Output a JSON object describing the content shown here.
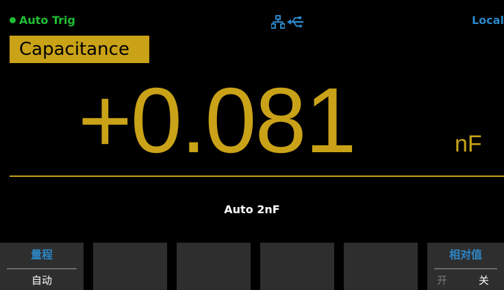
{
  "status": {
    "trigger_label": "Auto Trig",
    "network_icon": "lan-icon",
    "usb_icon": "usb-icon",
    "mode_label": "Local"
  },
  "function": {
    "label": "Capacitance"
  },
  "measurement": {
    "value": "+0.081",
    "unit": "nF"
  },
  "range_info": "Auto 2nF",
  "softkeys": [
    {
      "title": "量程",
      "value": "自动"
    },
    {
      "title": "",
      "value": ""
    },
    {
      "title": "",
      "value": ""
    },
    {
      "title": "",
      "value": ""
    },
    {
      "title": "",
      "value": ""
    },
    {
      "title": "相对值",
      "on_label": "开",
      "off_label": "关"
    }
  ],
  "colors": {
    "accent": "#c9a218",
    "trigger": "#1fbe33",
    "info": "#2c87c8",
    "softkey_bg": "#2e2e2e"
  }
}
